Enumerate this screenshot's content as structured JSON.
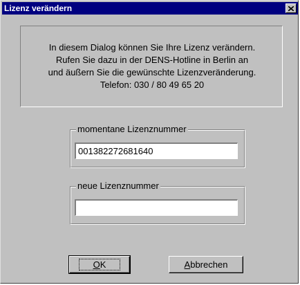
{
  "dialog": {
    "title": "Lizenz verändern",
    "close_symbol": "×"
  },
  "info": {
    "lines": [
      "In diesem Dialog können Sie Ihre Lizenz verändern.",
      "Rufen Sie dazu in der DENS-Hotline in Berlin an",
      "und äußern Sie die gewünschte Lizenzveränderung.",
      "Telefon: 030 / 80 49 65 20"
    ]
  },
  "current_license": {
    "label": "momentane Lizenznummer",
    "value": "001382272681640"
  },
  "new_license": {
    "label": "neue Lizenznummer",
    "value": ""
  },
  "buttons": {
    "ok": {
      "mnemonic": "O",
      "rest": "K"
    },
    "cancel": {
      "mnemonic": "A",
      "rest": "bbrechen"
    }
  }
}
